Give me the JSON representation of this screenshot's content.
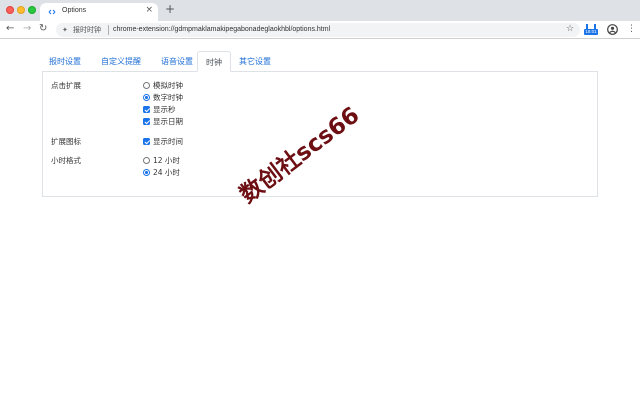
{
  "browser": {
    "tab_title": "Options",
    "tab_close": "×",
    "new_tab": "+",
    "nav": {
      "back": "←",
      "forward": "→",
      "reload": "↻"
    },
    "omnibox": {
      "site_icon": "puzzle-icon",
      "site_name": "报时时钟",
      "url": "chrome-extension://gdmpmaklamakipegabonadeglaokhbl/options.html"
    },
    "star": "☆",
    "extension_badge": "18:01",
    "menu": "⋮"
  },
  "tabs": [
    {
      "label": "报时设置",
      "active": false
    },
    {
      "label": "自定义提醒",
      "active": false
    },
    {
      "label": "语音设置",
      "active": false
    },
    {
      "label": "时钟",
      "active": true
    },
    {
      "label": "其它设置",
      "active": false
    }
  ],
  "settings": {
    "click_extension": {
      "label": "点击扩展",
      "options": [
        {
          "text": "模拟时钟",
          "type": "radio",
          "checked": false
        },
        {
          "text": "数字时钟",
          "type": "radio",
          "checked": true
        },
        {
          "text": "显示秒",
          "type": "checkbox",
          "checked": true
        },
        {
          "text": "显示日期",
          "type": "checkbox",
          "checked": true
        }
      ]
    },
    "extension_icon": {
      "label": "扩展图标",
      "options": [
        {
          "text": "显示时间",
          "type": "checkbox",
          "checked": true
        }
      ]
    },
    "hour_format": {
      "label": "小时格式",
      "options": [
        {
          "text": "12 小时",
          "type": "radio",
          "checked": false
        },
        {
          "text": "24 小时",
          "type": "radio",
          "checked": true
        }
      ]
    }
  },
  "watermark": "数创社scs66",
  "colors": {
    "accent": "#1a73e8",
    "link": "#1f6fd6",
    "watermark": "#6d0e12"
  }
}
